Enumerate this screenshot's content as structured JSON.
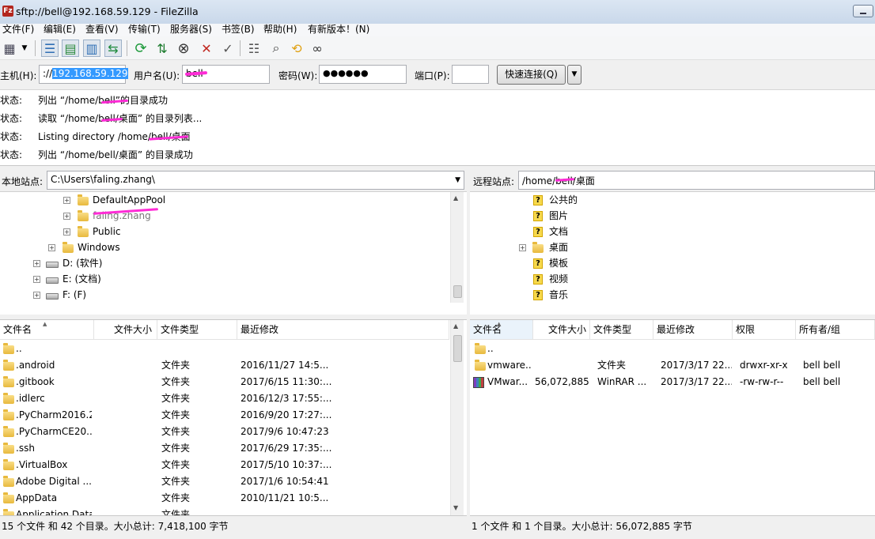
{
  "window": {
    "title": "sftp://bell@192.168.59.129 - FileZilla",
    "app_icon": "Fz"
  },
  "menu": [
    "文件(F)",
    "编辑(E)",
    "查看(V)",
    "传输(T)",
    "服务器(S)",
    "书签(B)",
    "帮助(H)",
    "有新版本！(N)"
  ],
  "quickconnect": {
    "host_label": "主机(H):",
    "host_prefix": "://",
    "host_value": "192.168.59.129",
    "user_label": "用户名(U):",
    "user_value": "bell",
    "pass_label": "密码(W):",
    "pass_value": "●●●●●●",
    "port_label": "端口(P):",
    "port_value": "",
    "connect_button": "快速连接(Q)"
  },
  "log": [
    {
      "label": "状态:",
      "msg": "列出 “/home/bell”的目录成功"
    },
    {
      "label": "状态:",
      "msg": "读取 “/home/bell/桌面” 的目录列表..."
    },
    {
      "label": "状态:",
      "msg": "Listing directory /home/bell/桌面"
    },
    {
      "label": "状态:",
      "msg": "列出 “/home/bell/桌面” 的目录成功"
    }
  ],
  "local": {
    "site_label": "本地站点:",
    "path": "C:\\Users\\faling.zhang\\",
    "tree": [
      {
        "label": "DefaultAppPool"
      },
      {
        "label": "faling.zhang"
      },
      {
        "label": "Public"
      },
      {
        "label": "Windows"
      },
      {
        "label": "D: (软件)"
      },
      {
        "label": "E: (文档)"
      },
      {
        "label": "F: (F)"
      }
    ],
    "columns": [
      "文件名",
      "文件大小",
      "文件类型",
      "最近修改"
    ],
    "files": [
      {
        "name": "..",
        "size": "",
        "type": "",
        "modified": ""
      },
      {
        "name": ".android",
        "size": "",
        "type": "文件夹",
        "modified": "2016/11/27 14:5..."
      },
      {
        "name": ".gitbook",
        "size": "",
        "type": "文件夹",
        "modified": "2017/6/15 11:30:..."
      },
      {
        "name": ".idlerc",
        "size": "",
        "type": "文件夹",
        "modified": "2016/12/3 17:55:..."
      },
      {
        "name": ".PyCharm2016.2",
        "size": "",
        "type": "文件夹",
        "modified": "2016/9/20 17:27:..."
      },
      {
        "name": ".PyCharmCE20...",
        "size": "",
        "type": "文件夹",
        "modified": "2017/9/6 10:47:23"
      },
      {
        "name": ".ssh",
        "size": "",
        "type": "文件夹",
        "modified": "2017/6/29 17:35:..."
      },
      {
        "name": ".VirtualBox",
        "size": "",
        "type": "文件夹",
        "modified": "2017/5/10 10:37:..."
      },
      {
        "name": "Adobe Digital ...",
        "size": "",
        "type": "文件夹",
        "modified": "2017/1/6 10:54:41"
      },
      {
        "name": "AppData",
        "size": "",
        "type": "文件夹",
        "modified": "2010/11/21 10:5..."
      },
      {
        "name": "Application Data",
        "size": "",
        "type": "文件夹",
        "modified": ""
      }
    ],
    "status": "15 个文件 和 42 个目录。大小总计: 7,418,100 字节"
  },
  "remote": {
    "site_label": "远程站点:",
    "path": "/home/bell/桌面",
    "tree": [
      {
        "label": "公共的"
      },
      {
        "label": "图片"
      },
      {
        "label": "文档"
      },
      {
        "label": "桌面"
      },
      {
        "label": "模板"
      },
      {
        "label": "视频"
      },
      {
        "label": "音乐"
      }
    ],
    "columns": [
      "文件名",
      "文件大小",
      "文件类型",
      "最近修改",
      "权限",
      "所有者/组"
    ],
    "files": [
      {
        "name": "..",
        "size": "",
        "type": "",
        "modified": "",
        "perms": "",
        "owner": ""
      },
      {
        "name": "vmware...",
        "size": "",
        "type": "文件夹",
        "modified": "2017/3/17 22...",
        "perms": "drwxr-xr-x",
        "owner": "bell bell"
      },
      {
        "name": "VMwar...",
        "size": "56,072,885",
        "type": "WinRAR ...",
        "modified": "2017/3/17 22...",
        "perms": "-rw-rw-r--",
        "owner": "bell bell"
      }
    ],
    "status": "1 个文件 和 1 个目录。大小总计: 56,072,885 字节"
  },
  "toolbar_icons": [
    "site-manager-icon",
    "dropdown-arrow-icon",
    "toggle-log-icon",
    "toggle-local-tree-icon",
    "toggle-remote-tree-icon",
    "toggle-queue-icon",
    "refresh-icon",
    "process-queue-icon",
    "cancel-icon",
    "disconnect-icon",
    "reconnect-icon",
    "directory-filter-icon",
    "search-files-icon",
    "sync-browse-icon",
    "compare-icon"
  ]
}
